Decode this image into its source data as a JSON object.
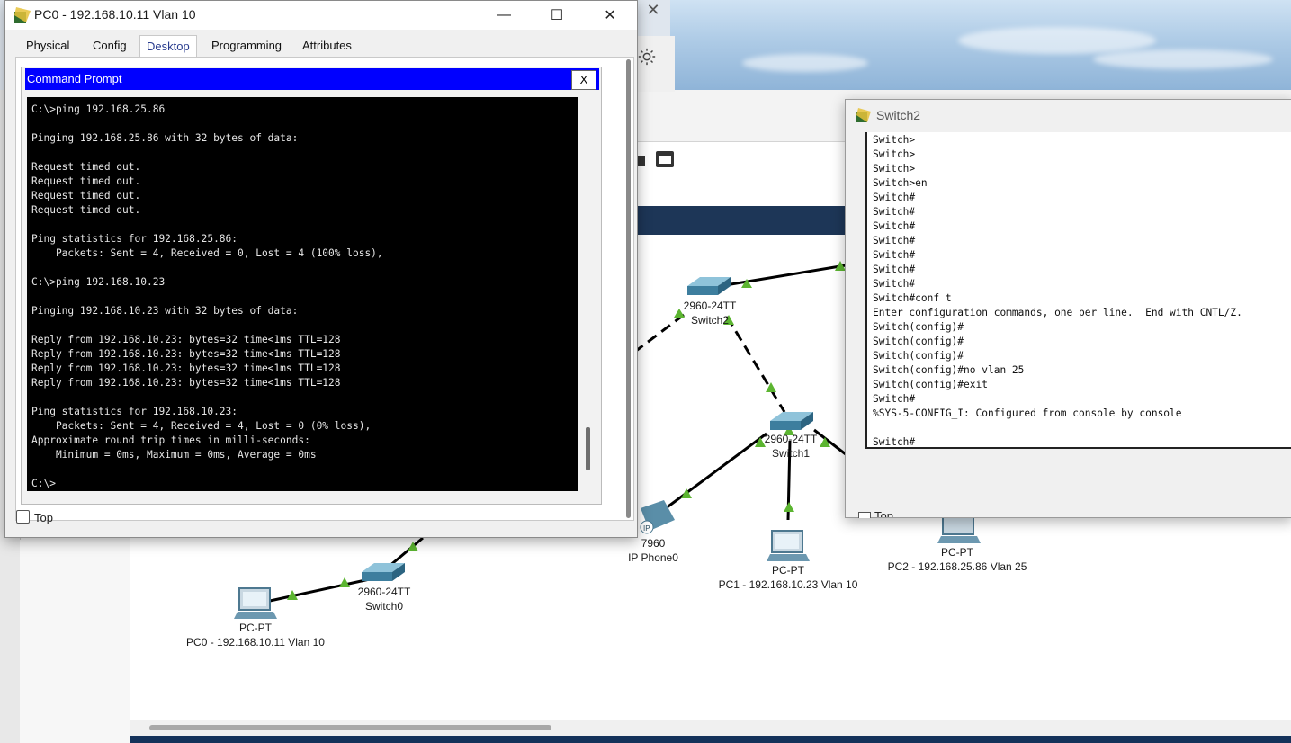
{
  "pc0_window": {
    "title": "PC0 - 192.168.10.11 Vlan 10",
    "tabs": [
      "Physical",
      "Config",
      "Desktop",
      "Programming",
      "Attributes"
    ],
    "active_tab": "Desktop",
    "cmd_title": "Command Prompt",
    "cmd_close": "X",
    "terminal": "C:\\>ping 192.168.25.86\n\nPinging 192.168.25.86 with 32 bytes of data:\n\nRequest timed out.\nRequest timed out.\nRequest timed out.\nRequest timed out.\n\nPing statistics for 192.168.25.86:\n    Packets: Sent = 4, Received = 0, Lost = 4 (100% loss),\n\nC:\\>ping 192.168.10.23\n\nPinging 192.168.10.23 with 32 bytes of data:\n\nReply from 192.168.10.23: bytes=32 time<1ms TTL=128\nReply from 192.168.10.23: bytes=32 time<1ms TTL=128\nReply from 192.168.10.23: bytes=32 time<1ms TTL=128\nReply from 192.168.10.23: bytes=32 time<1ms TTL=128\n\nPing statistics for 192.168.10.23:\n    Packets: Sent = 4, Received = 4, Lost = 0 (0% loss),\nApproximate round trip times in milli-seconds:\n    Minimum = 0ms, Maximum = 0ms, Average = 0ms\n\nC:\\>",
    "top_checkbox_label": "Top",
    "top_checked": false,
    "minimize": "—",
    "maximize": "☐",
    "close": "✕"
  },
  "switch2_window": {
    "title": "Switch2",
    "terminal": "Switch>\nSwitch>\nSwitch>\nSwitch>en\nSwitch#\nSwitch#\nSwitch#\nSwitch#\nSwitch#\nSwitch#\nSwitch#\nSwitch#conf t\nEnter configuration commands, one per line.  End with CNTL/Z.\nSwitch(config)#\nSwitch(config)#\nSwitch(config)#\nSwitch(config)#no vlan 25\nSwitch(config)#exit\nSwitch#\n%SYS-5-CONFIG_I: Configured from console by console\n\nSwitch#",
    "top_checkbox_label": "Top"
  },
  "behind_window_close": "✕",
  "topology": {
    "devices": [
      {
        "model": "2960-24TT",
        "name": "Switch2"
      },
      {
        "model": "2960-24TT",
        "name": "Switch1"
      },
      {
        "model": "2960-24TT",
        "name": "Switch0"
      },
      {
        "model": "7960",
        "name": "IP Phone0"
      },
      {
        "model": "PC-PT",
        "name": "PC1 - 192.168.10.23 Vlan 10"
      },
      {
        "model": "PC-PT",
        "name": "PC2 - 192.168.25.86 Vlan 25"
      },
      {
        "model": "PC-PT",
        "name": "PC0 - 192.168.10.11 Vlan 10"
      }
    ],
    "link_light_color": "#5cb531",
    "switch_color": "#4a8fb0"
  },
  "colors": {
    "cmd_header": "#0000ff",
    "terminal_bg": "#000000",
    "nav_bar": "#1d3657",
    "active_tab_underline": "#2a67c9"
  }
}
